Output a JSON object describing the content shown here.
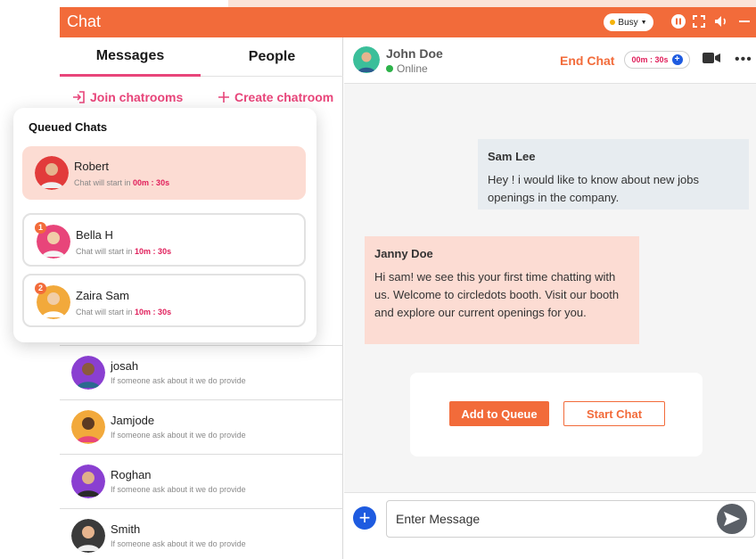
{
  "window": {
    "title": "Chat",
    "status": "Busy"
  },
  "left_panel": {
    "tabs": [
      {
        "label": "Messages"
      },
      {
        "label": "People"
      }
    ],
    "join_label": "Join chatrooms",
    "create_label": "Create chatroom",
    "contacts": [
      {
        "name": "josah",
        "preview": "If someone ask about it we do provide"
      },
      {
        "name": "Jamjode",
        "preview": "If someone ask about it we do provide"
      },
      {
        "name": "Roghan",
        "preview": "If someone ask about it we do provide"
      },
      {
        "name": "Smith",
        "preview": "If someone ask about it we do provide"
      }
    ]
  },
  "queue": {
    "title": "Queued Chats",
    "items": [
      {
        "name": "Robert",
        "prefix": "Chat will start in",
        "time": "00m : 30s"
      },
      {
        "name": "Bella H",
        "badge": "1",
        "prefix": "Chat will start in",
        "time": "10m : 30s"
      },
      {
        "name": "Zaira Sam",
        "badge": "2",
        "prefix": "Chat will start in",
        "time": "10m : 30s"
      }
    ]
  },
  "chat": {
    "contact_name": "John Doe",
    "contact_status": "Online",
    "end_chat_label": "End Chat",
    "timer": "00m : 30s",
    "messages": [
      {
        "sender": "Sam Lee",
        "text": "Hey ! i would like to  know about new jobs openings in the company."
      },
      {
        "sender": "Janny Doe",
        "text": "Hi sam! we see this your first time chatting with us. Welcome to circledots booth. Visit our booth and explore our current openings for you."
      }
    ],
    "add_to_queue_label": "Add to Queue",
    "start_chat_label": "Start Chat",
    "input_placeholder": "Enter Message"
  },
  "colors": {
    "brand": "#f26b3a",
    "accent_pink": "#e8457a",
    "online": "#2db34a",
    "blue": "#1e5be0"
  }
}
